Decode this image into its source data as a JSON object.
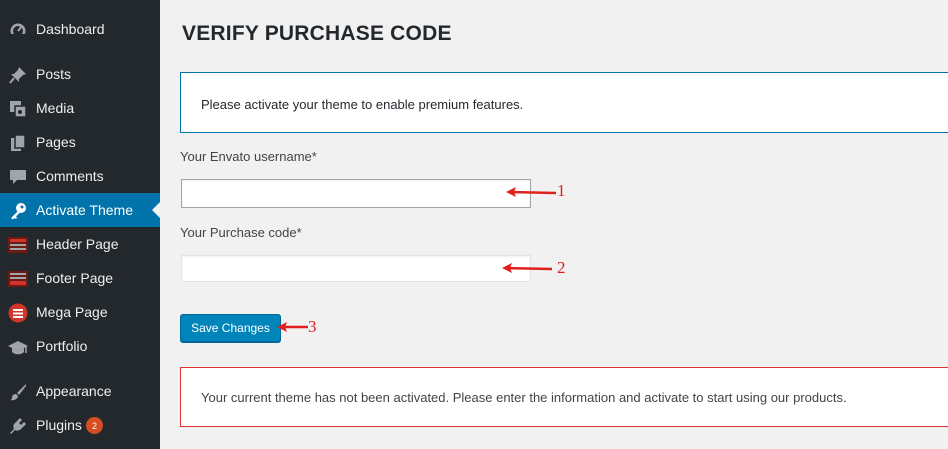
{
  "sidebar": {
    "items": [
      {
        "label": "Dashboard",
        "icon": "dashboard-icon"
      },
      {
        "label": "Posts",
        "icon": "pin-icon"
      },
      {
        "label": "Media",
        "icon": "media-icon"
      },
      {
        "label": "Pages",
        "icon": "pages-icon"
      },
      {
        "label": "Comments",
        "icon": "comment-icon"
      },
      {
        "label": "Activate Theme",
        "icon": "key-icon",
        "active": true
      },
      {
        "label": "Header Page",
        "icon": "header-page-icon"
      },
      {
        "label": "Footer Page",
        "icon": "footer-page-icon"
      },
      {
        "label": "Mega Page",
        "icon": "mega-page-icon"
      },
      {
        "label": "Portfolio",
        "icon": "portfolio-icon"
      },
      {
        "label": "Appearance",
        "icon": "paintbrush-icon"
      },
      {
        "label": "Plugins",
        "icon": "plugin-icon",
        "badge": "2"
      }
    ]
  },
  "main": {
    "title": "VERIFY PURCHASE CODE",
    "info_notice": "Please activate your theme to enable premium features.",
    "username_label": "Your Envato username*",
    "username_value": "",
    "purchase_label": "Your Purchase code*",
    "purchase_value": "",
    "save_label": "Save Changes",
    "error_notice": "Your current theme has not been activated. Please enter the information and activate to start using our products."
  },
  "annotations": {
    "one": "1",
    "two": "2",
    "three": "3"
  },
  "colors": {
    "sidebar_bg": "#23282d",
    "active_bg": "#0073aa",
    "button_bg": "#0085ba",
    "error_border": "#dc3232",
    "annotation_red": "#e0201d",
    "badge_bg": "#d54e21"
  }
}
